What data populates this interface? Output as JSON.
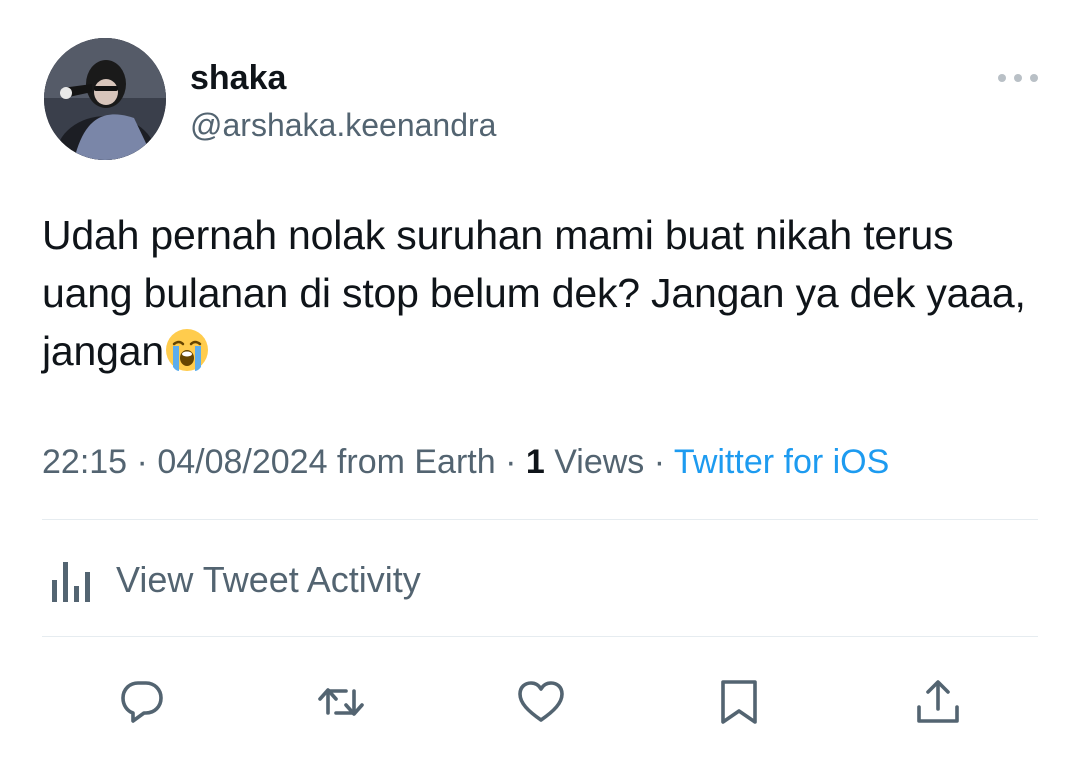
{
  "author": {
    "display_name": "shaka",
    "handle": "@arshaka.keenandra",
    "avatar_icon": "profile-photo"
  },
  "tweet": {
    "text": "Udah pernah nolak suruhan mami buat nikah terus uang bulanan di stop belum dek? Jangan ya dek yaaa, jangan",
    "emoji": "loudly-crying-face"
  },
  "meta": {
    "time": "22:15",
    "sep1": " · ",
    "date": "04/08/2024 from Earth",
    "sep2": " · ",
    "views_count": "1",
    "views_label": " Views",
    "sep3": " · ",
    "source": "Twitter for iOS"
  },
  "activity": {
    "label": "View Tweet Activity"
  },
  "actions": [
    "reply-icon",
    "retweet-icon",
    "like-icon",
    "bookmark-icon",
    "share-icon"
  ],
  "colors": {
    "text": "#0f1419",
    "muted": "#536471",
    "link": "#1d9bf0",
    "divider": "#e6ecf0"
  }
}
